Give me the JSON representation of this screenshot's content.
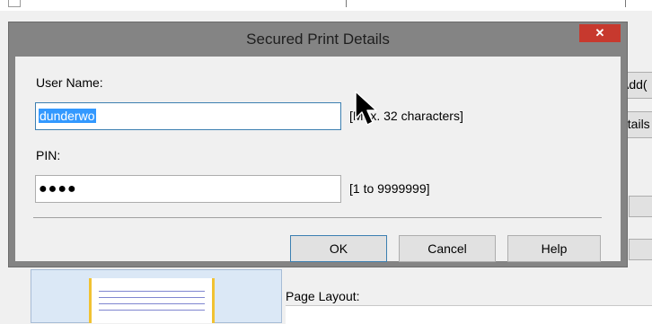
{
  "dialog": {
    "title": "Secured Print Details",
    "close_glyph": "✕",
    "user_name_label": "User Name:",
    "user_name_value": "dunderwo",
    "user_name_hint": "[Max. 32 characters]",
    "pin_label": "PIN:",
    "pin_mask": "●●●●",
    "pin_hint": "[1 to 9999999]",
    "ok_label": "OK",
    "cancel_label": "Cancel",
    "help_label": "Help"
  },
  "background": {
    "add_button_label": "Add(",
    "details_button_label": "etails",
    "page_layout_label": "Page Layout:"
  },
  "colors": {
    "close_button": "#c7392e",
    "selection": "#3399ff",
    "focus_border": "#3c7fb1"
  }
}
